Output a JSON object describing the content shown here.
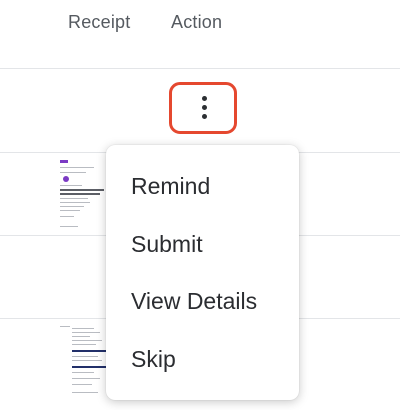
{
  "table": {
    "columns": {
      "receipt": "Receipt",
      "action": "Action"
    }
  },
  "row_action": {
    "icon": "kebab-vertical-icon",
    "highlight_color": "#e5482f"
  },
  "action_menu": {
    "items": [
      {
        "label": "Remind"
      },
      {
        "label": "Submit"
      },
      {
        "label": "View Details"
      },
      {
        "label": "Skip"
      }
    ]
  },
  "colors": {
    "header_text": "#555a60",
    "menu_text": "#2b2d31",
    "divider": "#e3e5e8"
  }
}
